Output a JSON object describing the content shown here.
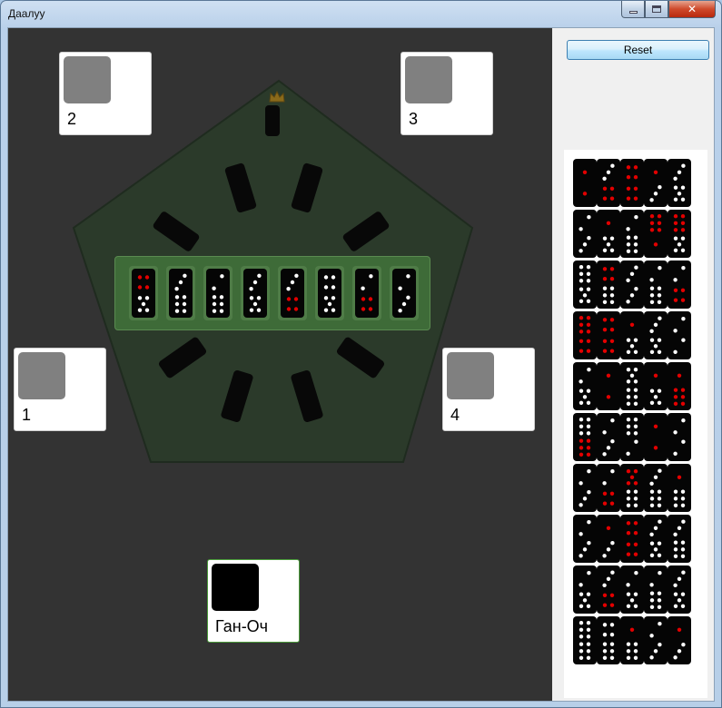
{
  "window": {
    "title": "Даалуу"
  },
  "side": {
    "reset_label": "Reset"
  },
  "players": {
    "p1": {
      "name": "1"
    },
    "p2": {
      "name": "2"
    },
    "p3": {
      "name": "3"
    },
    "p4": {
      "name": "4"
    },
    "me": {
      "name": "Ган-Оч"
    }
  },
  "hand": [
    {
      "top": "4R",
      "bot": "5W"
    },
    {
      "top": "3W",
      "bot": "6W"
    },
    {
      "top": "2W",
      "bot": "6W"
    },
    {
      "top": "3W",
      "bot": "5W"
    },
    {
      "top": "3W",
      "bot": "4R"
    },
    {
      "top": "4W",
      "bot": "5W"
    },
    {
      "top": "2W",
      "bot": "4R"
    },
    {
      "top": "2W",
      "bot": "3W"
    }
  ],
  "pool": [
    [
      "1R/1R",
      "3W/4R",
      "4R/4R",
      "1R/3W",
      "3W/5W"
    ],
    [
      "2W/3W",
      "1R/5W",
      "2W/6W",
      "6R/1R",
      "6R/5W"
    ],
    [
      "6W/5W",
      "4R/6W",
      "3W/3W",
      "2W/6W",
      "2W/4R"
    ],
    [
      "6R/4R",
      "4R/4R",
      "1R/5W",
      "3W/5W",
      "2W/2W"
    ],
    [
      "2W/5W",
      "1R/1R",
      "5W/6W",
      "1R/5W",
      "1R/6R"
    ],
    [
      "6W/6R",
      "2W/3W",
      "6W/2W",
      "1R/1R",
      "2W/2W"
    ],
    [
      "2W/3W",
      "2W/4R",
      "5R/6W",
      "3W/6W",
      "1R/6W"
    ],
    [
      "2W/3W",
      "1R/3W",
      "4R/4R",
      "3W/5W",
      "3W/6W"
    ],
    [
      "2W/5W",
      "3W/4R",
      "2W/5W",
      "2W/6W",
      "3W/5W"
    ],
    [
      "6W/6W",
      "4W/6W",
      "1R/6W",
      "2W/3W",
      "1R/3W"
    ]
  ]
}
